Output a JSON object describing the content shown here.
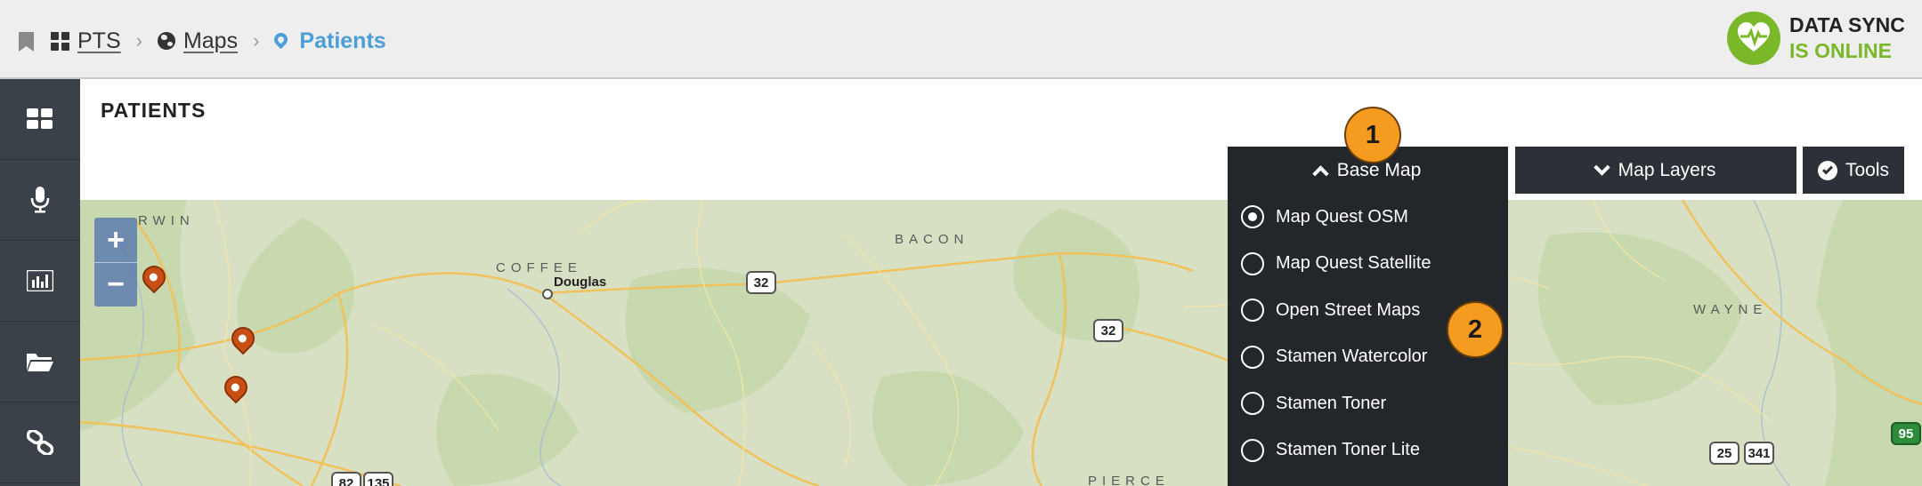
{
  "breadcrumbs": [
    {
      "label": "PTS",
      "icon": "dashboard-grid-icon"
    },
    {
      "label": "Maps",
      "icon": "globe-icon"
    },
    {
      "label": "Patients",
      "icon": "map-pin-icon"
    }
  ],
  "sync_status": {
    "line1": "DATA SYNC",
    "line2": "IS ONLINE",
    "icon": "heartbeat-icon",
    "color": "#7ab82a"
  },
  "sidebar": {
    "items": [
      {
        "name": "dashboard",
        "icon": "dashboard-grid-icon"
      },
      {
        "name": "microphone",
        "icon": "microphone-icon"
      },
      {
        "name": "reports",
        "icon": "bar-chart-icon"
      },
      {
        "name": "files",
        "icon": "folder-open-icon"
      },
      {
        "name": "links",
        "icon": "link-icon"
      }
    ]
  },
  "page_title": "PATIENTS",
  "toolbar": {
    "base_map_label": "Base Map",
    "map_layers_label": "Map Layers",
    "tools_label": "Tools"
  },
  "base_map_options": [
    {
      "label": "Map Quest OSM",
      "selected": true
    },
    {
      "label": "Map Quest Satellite",
      "selected": false
    },
    {
      "label": "Open Street Maps",
      "selected": false
    },
    {
      "label": "Stamen Watercolor",
      "selected": false
    },
    {
      "label": "Stamen Toner",
      "selected": false
    },
    {
      "label": "Stamen Toner Lite",
      "selected": false
    }
  ],
  "map": {
    "zoom_in": "+",
    "zoom_out": "−",
    "labels": [
      "RWIN",
      "COFFEE",
      "BACON",
      "WAYNE",
      "PIERCE"
    ],
    "city": "Douglas",
    "shields": [
      "32",
      "32",
      "25",
      "341",
      "95",
      "82",
      "135"
    ]
  },
  "callouts": [
    "1",
    "2"
  ],
  "colors": {
    "accent": "#4a9fd8",
    "sidebar": "#3b4148",
    "dropdown": "#23272c",
    "callout": "#f59b20",
    "marker": "#c84f14"
  }
}
